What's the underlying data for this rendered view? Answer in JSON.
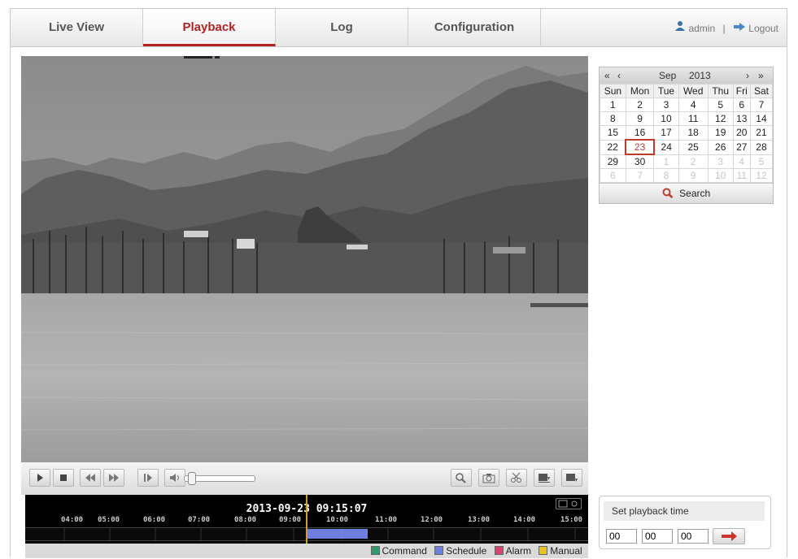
{
  "nav": {
    "tabs": [
      {
        "label": "Live View"
      },
      {
        "label": "Playback"
      },
      {
        "label": "Log"
      },
      {
        "label": "Configuration"
      }
    ],
    "active_tab": "Playback",
    "user": "admin",
    "separator": "|",
    "logout": "Logout"
  },
  "toolbar": {
    "left_icons": [
      "play-icon",
      "stop-icon",
      "slow-forward-icon",
      "fast-forward-icon",
      "single-frame-icon",
      "volume-icon"
    ],
    "right_icons": [
      "digital-zoom-icon",
      "capture-icon",
      "clip-icon",
      "download-by-file-icon",
      "download-by-time-icon"
    ],
    "volume_level": 0.05
  },
  "timeline": {
    "current_time": "2013-09-23 09:15:07",
    "ticks": [
      "04:00",
      "05:00",
      "06:00",
      "07:00",
      "08:00",
      "09:00",
      "10:00",
      "11:00",
      "12:00",
      "13:00",
      "14:00",
      "15:00"
    ],
    "recording_segment": {
      "start": "09:15",
      "end": "10:45",
      "type": "Schedule"
    }
  },
  "legend": [
    {
      "label": "Command",
      "color": "#2e9b6f"
    },
    {
      "label": "Schedule",
      "color": "#6f7fe0"
    },
    {
      "label": "Alarm",
      "color": "#d9446f"
    },
    {
      "label": "Manual",
      "color": "#e8c21e"
    }
  ],
  "calendar": {
    "month": "Sep",
    "year": "2013",
    "weekdays": [
      "Sun",
      "Mon",
      "Tue",
      "Wed",
      "Thu",
      "Fri",
      "Sat"
    ],
    "weeks": [
      [
        {
          "d": "1"
        },
        {
          "d": "2"
        },
        {
          "d": "3"
        },
        {
          "d": "4"
        },
        {
          "d": "5"
        },
        {
          "d": "6"
        },
        {
          "d": "7"
        }
      ],
      [
        {
          "d": "8"
        },
        {
          "d": "9"
        },
        {
          "d": "10"
        },
        {
          "d": "11"
        },
        {
          "d": "12"
        },
        {
          "d": "13"
        },
        {
          "d": "14"
        }
      ],
      [
        {
          "d": "15"
        },
        {
          "d": "16"
        },
        {
          "d": "17"
        },
        {
          "d": "18"
        },
        {
          "d": "19"
        },
        {
          "d": "20"
        },
        {
          "d": "21"
        }
      ],
      [
        {
          "d": "22"
        },
        {
          "d": "23",
          "today": true
        },
        {
          "d": "24"
        },
        {
          "d": "25"
        },
        {
          "d": "26"
        },
        {
          "d": "27"
        },
        {
          "d": "28"
        }
      ],
      [
        {
          "d": "29"
        },
        {
          "d": "30"
        },
        {
          "d": "1",
          "other": true
        },
        {
          "d": "2",
          "other": true
        },
        {
          "d": "3",
          "other": true
        },
        {
          "d": "4",
          "other": true
        },
        {
          "d": "5",
          "other": true
        }
      ],
      [
        {
          "d": "6",
          "other": true
        },
        {
          "d": "7",
          "other": true
        },
        {
          "d": "8",
          "other": true
        },
        {
          "d": "9",
          "other": true
        },
        {
          "d": "10",
          "other": true
        },
        {
          "d": "11",
          "other": true
        },
        {
          "d": "12",
          "other": true
        }
      ]
    ],
    "search_label": "Search"
  },
  "playback_time": {
    "title": "Set playback time",
    "hour": "00",
    "minute": "00",
    "second": "00"
  },
  "colors": {
    "accent": "#b22222",
    "cursor": "#d4a017"
  }
}
